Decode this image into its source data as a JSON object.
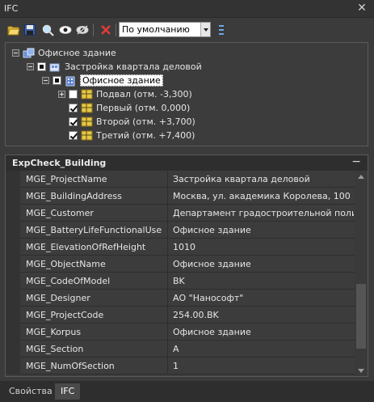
{
  "window": {
    "title": "IFC",
    "close_glyph": "✕"
  },
  "toolbar": {
    "icons": [
      "folder-open-icon",
      "save-icon",
      "search-icon",
      "eye-icon",
      "eye-hidden-icon",
      "delete-icon"
    ],
    "combo_value": "По умолчанию"
  },
  "tree": {
    "root": {
      "label": "Офисное здание"
    },
    "site": {
      "label": "Застройка квартала деловой"
    },
    "building": {
      "label": "Офисное здание"
    },
    "storeys": [
      {
        "label": "Подвал (отм. -3,300)",
        "checked": false,
        "expandable": true
      },
      {
        "label": "Первый (отм. 0,000)",
        "checked": true,
        "expandable": false
      },
      {
        "label": "Второй (отм. +3,700)",
        "checked": true,
        "expandable": false
      },
      {
        "label": "Третий (отм. +7,400)",
        "checked": true,
        "expandable": false
      }
    ]
  },
  "properties": {
    "title": "ExpCheck_Building",
    "collapse_glyph": "−",
    "rows": [
      {
        "key": "MGE_ProjectName",
        "value": "Застройка квартала деловой"
      },
      {
        "key": "MGE_BuildingAddress",
        "value": "Москва, ул. академика Королева, 100"
      },
      {
        "key": "MGE_Customer",
        "value": "Департамент градостроительной политики"
      },
      {
        "key": "MGE_BatteryLifeFunctionalUse",
        "value": "Офисное здание"
      },
      {
        "key": "MGE_ElevationOfRefHeight",
        "value": "1010"
      },
      {
        "key": "MGE_ObjectName",
        "value": "Офисное здание"
      },
      {
        "key": "MGE_CodeOfModel",
        "value": "BK"
      },
      {
        "key": "MGE_Designer",
        "value": "АО \"Нанософт\""
      },
      {
        "key": "MGE_ProjectCode",
        "value": "254.00.BK"
      },
      {
        "key": "MGE_Korpus",
        "value": "Офисное здание"
      },
      {
        "key": "MGE_Section",
        "value": "А"
      },
      {
        "key": "MGE_NumOfSection",
        "value": "1"
      }
    ]
  },
  "tabs": [
    {
      "label": "Свойства",
      "active": false
    },
    {
      "label": "IFC",
      "active": true
    }
  ]
}
